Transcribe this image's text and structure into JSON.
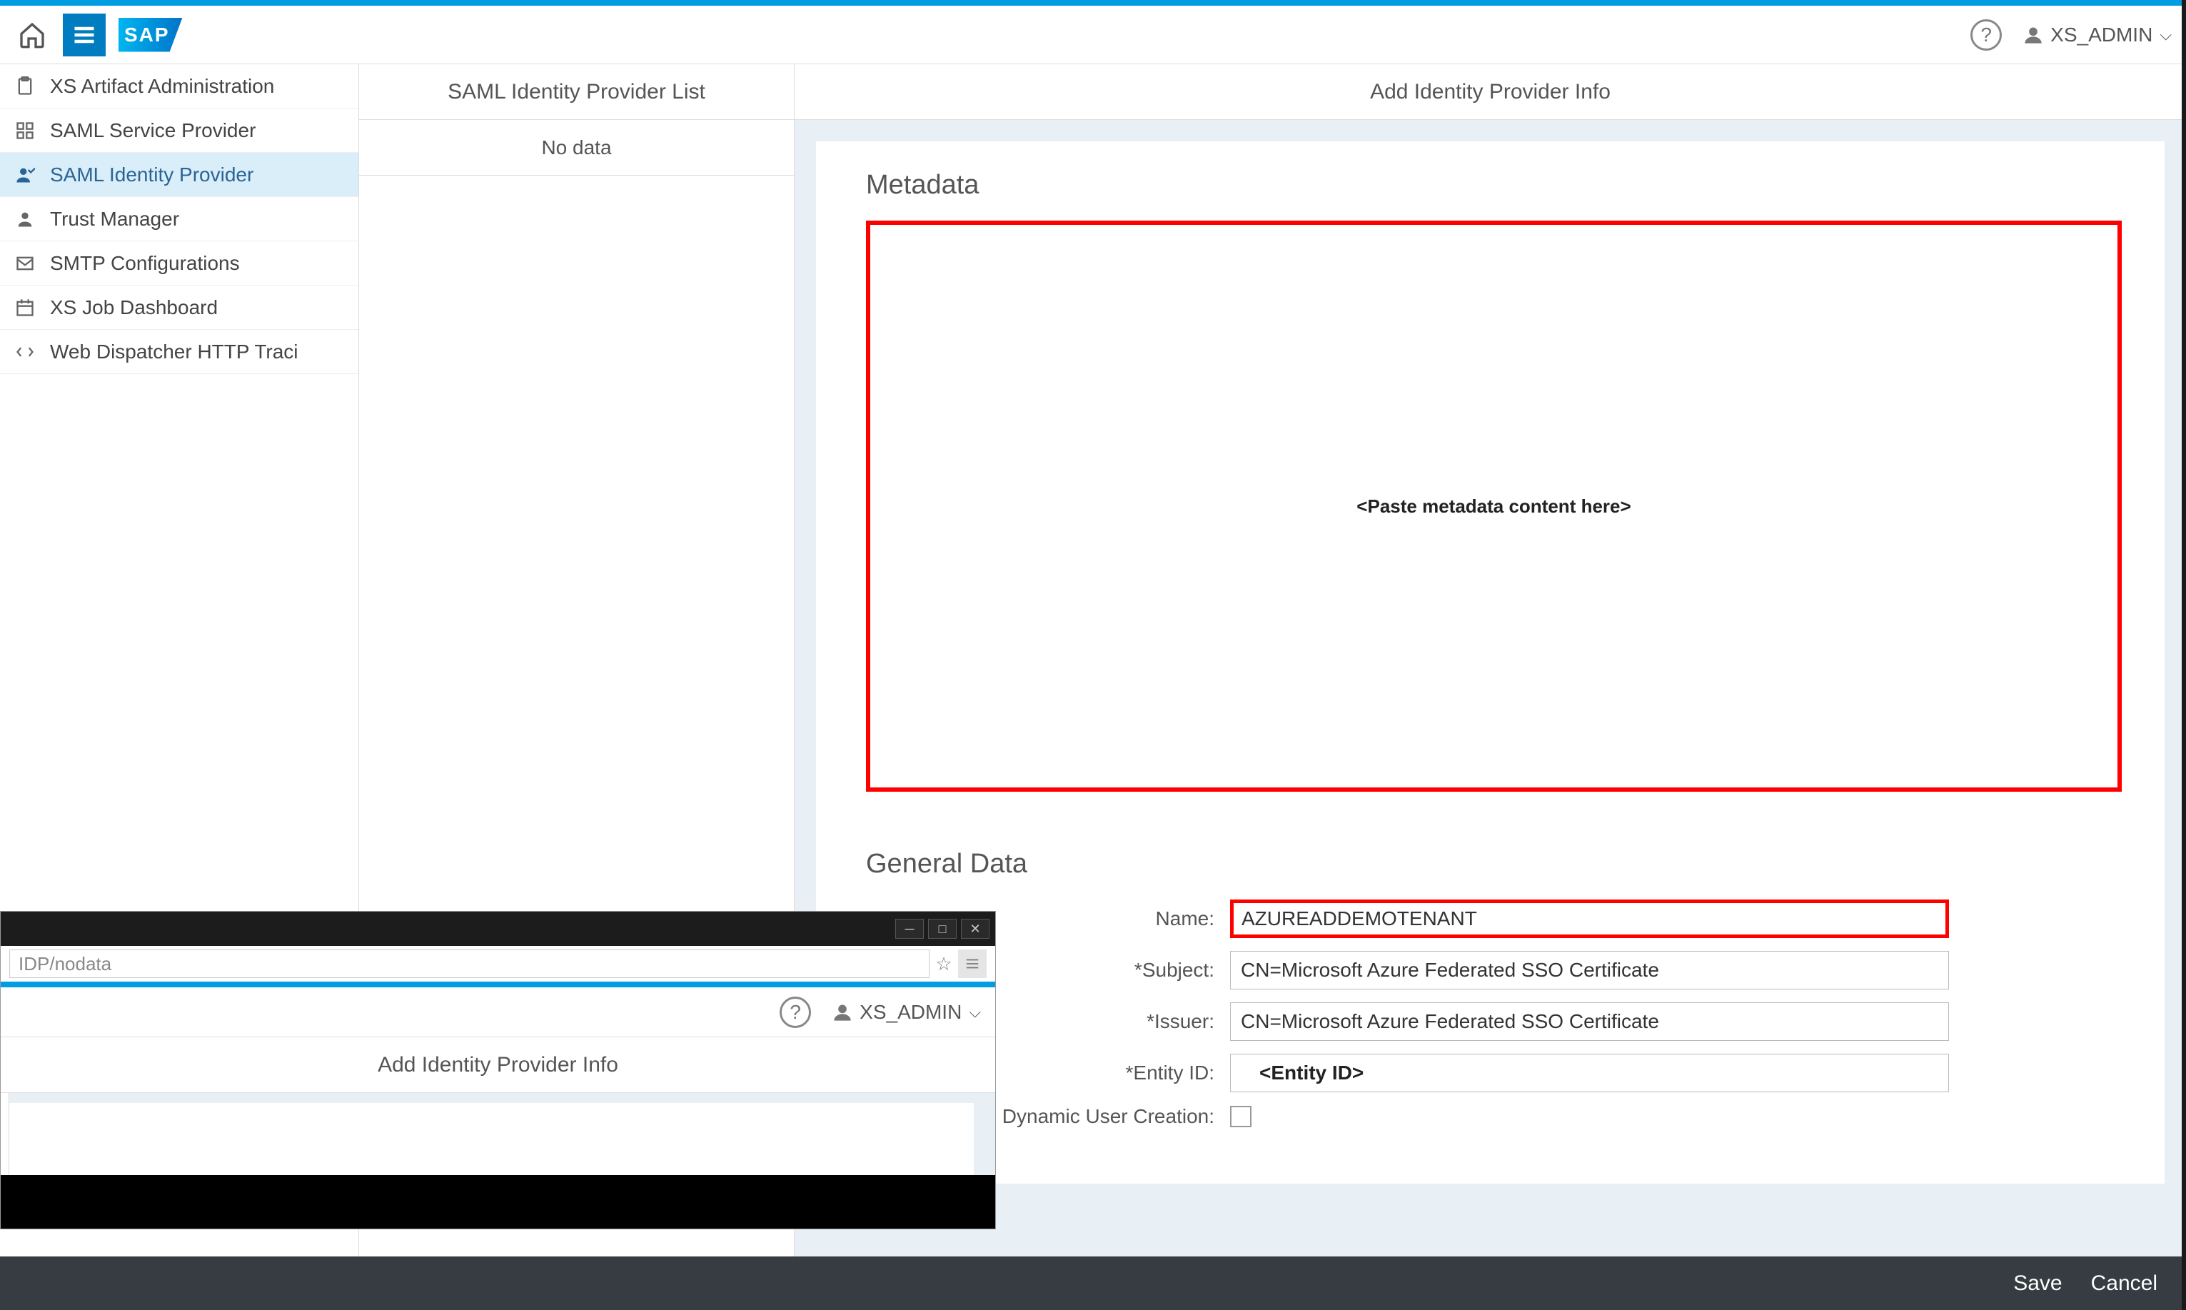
{
  "header": {
    "sap_logo": "SAP",
    "user_name": "XS_ADMIN"
  },
  "sidebar": {
    "items": [
      {
        "label": "XS Artifact Administration",
        "icon": "clipboard-icon"
      },
      {
        "label": "SAML Service Provider",
        "icon": "grid-icon"
      },
      {
        "label": "SAML Identity Provider",
        "icon": "user-check-icon"
      },
      {
        "label": "Trust Manager",
        "icon": "user-icon"
      },
      {
        "label": "SMTP Configurations",
        "icon": "mail-icon"
      },
      {
        "label": "XS Job Dashboard",
        "icon": "calendar-icon"
      },
      {
        "label": "Web Dispatcher HTTP Traci",
        "icon": "arrows-icon"
      }
    ],
    "active_index": 2
  },
  "mid_panel": {
    "title": "SAML Identity Provider List",
    "empty": "No data"
  },
  "main_panel": {
    "title": "Add Identity Provider Info",
    "metadata": {
      "section_title": "Metadata",
      "placeholder": "<Paste metadata content here>"
    },
    "general": {
      "section_title": "General Data",
      "fields": {
        "name_label": "Name:",
        "name_value": "AZUREADDEMOTENANT",
        "subject_label": "*Subject:",
        "subject_value": "CN=Microsoft Azure Federated SSO Certificate",
        "issuer_label": "*Issuer:",
        "issuer_value": "CN=Microsoft Azure Federated SSO Certificate",
        "entity_label": "*Entity ID:",
        "entity_placeholder": "<Entity ID>",
        "dynamic_label": "Dynamic User Creation:"
      }
    }
  },
  "footer": {
    "save_label": "Save",
    "cancel_label": "Cancel"
  },
  "overlay": {
    "url": "IDP/nodata",
    "user": "XS_ADMIN",
    "title": "Add Identity Provider Info"
  }
}
